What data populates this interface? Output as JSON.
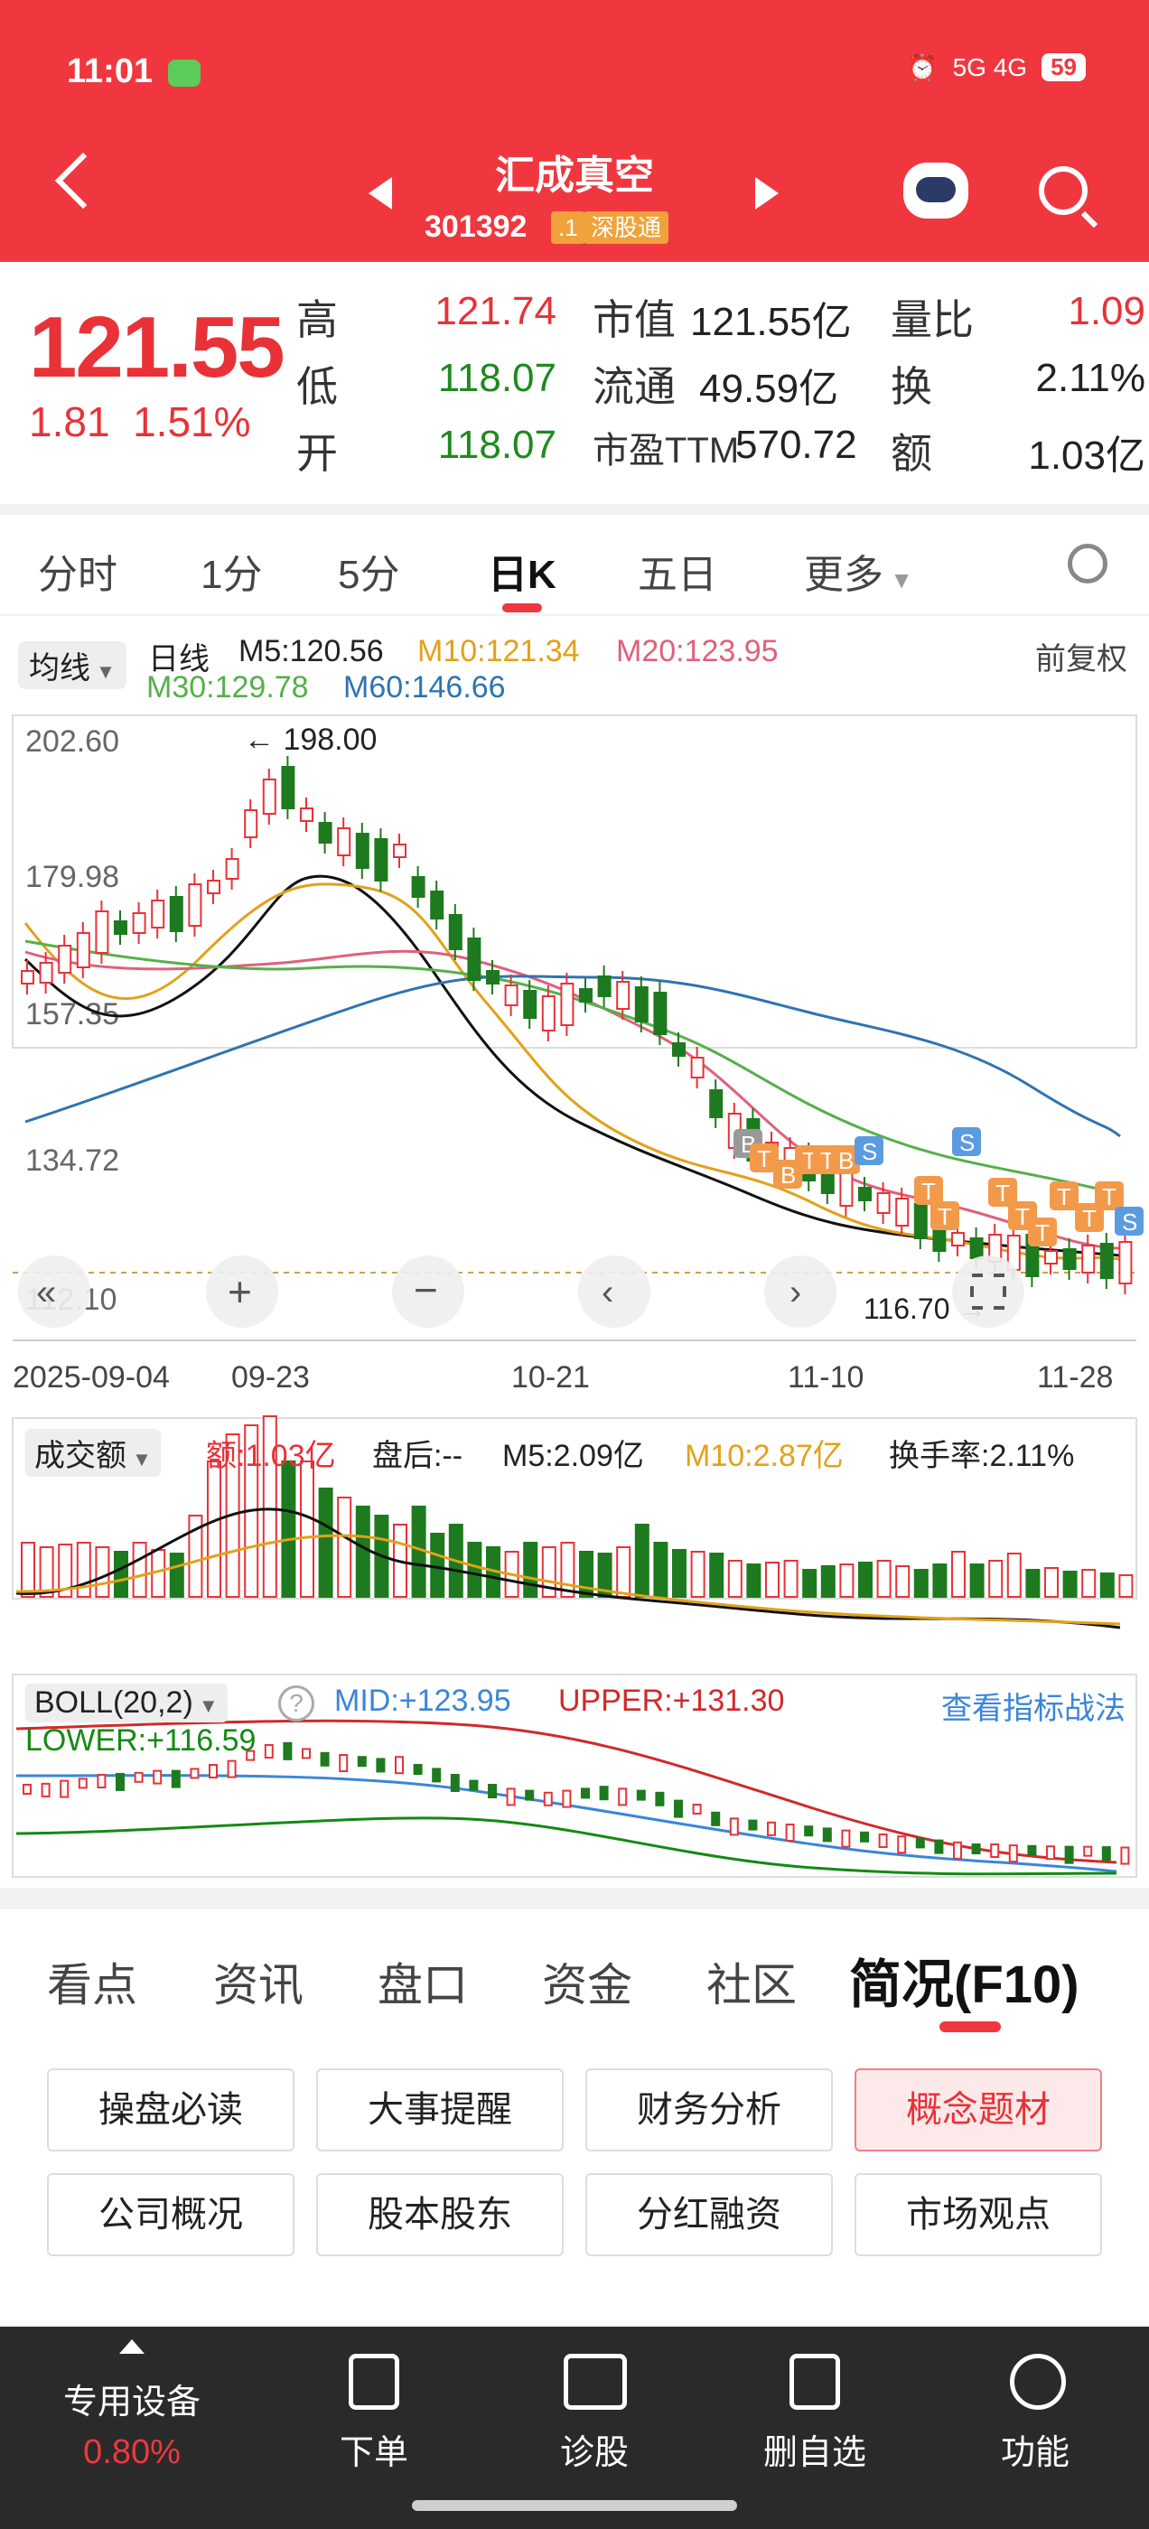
{
  "status": {
    "time": "11:01",
    "signal": "5G 4G",
    "battery": "59"
  },
  "header": {
    "stock_name": "汇成真空",
    "stock_code": "301392",
    "tag_level": ".1",
    "tag_connect": "深股通"
  },
  "quote": {
    "price": "121.55",
    "change": "1.81",
    "change_pct": "1.51%",
    "high_label": "高",
    "high": "121.74",
    "low_label": "低",
    "low": "118.07",
    "open_label": "开",
    "open": "118.07",
    "mcap_label": "市值",
    "mcap": "121.55亿",
    "float_label": "流通",
    "float": "49.59亿",
    "pe_label": "市盈TTM",
    "pe": "570.72",
    "vol_ratio_label": "量比",
    "vol_ratio": "1.09",
    "turnover_label": "换",
    "turnover": "2.11%",
    "amount_label": "额",
    "amount": "1.03亿"
  },
  "period_tabs": [
    "分时",
    "1分",
    "5分",
    "日K",
    "五日",
    "更多"
  ],
  "kline": {
    "ma_selector": "均线",
    "period": "日线",
    "m5": "M5:120.56",
    "m10": "M10:121.34",
    "m20": "M20:123.95",
    "m30": "M30:129.78",
    "m60": "M60:146.66",
    "adjust": "前复权",
    "y_ticks": [
      "202.60",
      "179.98",
      "157.35",
      "134.72",
      "112.10"
    ],
    "max_label": "198.00",
    "min_label": "116.70",
    "x_dates": [
      "2025-09-04",
      "09-23",
      "10-21",
      "11-10",
      "11-28"
    ]
  },
  "volume": {
    "selector": "成交额",
    "amount": "额:1.03亿",
    "after": "盘后:--",
    "m5": "M5:2.09亿",
    "m10": "M10:2.87亿",
    "turnover": "换手率:2.11%"
  },
  "boll": {
    "selector": "BOLL(20,2)",
    "mid": "MID:+123.95",
    "upper": "UPPER:+131.30",
    "lower": "LOWER:+116.59",
    "strategy_link": "查看指标战法"
  },
  "info_tabs": [
    "看点",
    "资讯",
    "盘口",
    "资金",
    "社区",
    "简况(F10)"
  ],
  "grid_buttons": [
    "操盘必读",
    "大事提醒",
    "财务分析",
    "概念题材",
    "公司概况",
    "股本股东",
    "分红融资",
    "市场观点"
  ],
  "bottom_nav": {
    "device_label": "专用设备",
    "device_pct": "0.80%",
    "order": "下单",
    "diagnose": "诊股",
    "remove": "删自选",
    "functions": "功能"
  },
  "colors": {
    "red": "#e83238",
    "green": "#1e7a1e",
    "header": "#f0373f",
    "m10": "#e2a11a",
    "m20": "#e0607a",
    "m30": "#55b04a",
    "m60": "#2f74b0"
  },
  "chart_data": {
    "type": "candlestick",
    "x": [
      "2025-09-04",
      "09-23",
      "10-21",
      "11-10",
      "11-28"
    ],
    "ylim": [
      112.1,
      202.6
    ],
    "y_ticks": [
      202.6,
      179.98,
      157.35,
      134.72,
      112.1
    ],
    "high_marker": 198.0,
    "low_marker": 116.7,
    "series": [
      {
        "name": "M5",
        "last": 120.56
      },
      {
        "name": "M10",
        "last": 121.34
      },
      {
        "name": "M20",
        "last": 123.95
      },
      {
        "name": "M30",
        "last": 129.78
      },
      {
        "name": "M60",
        "last": 146.66
      }
    ]
  }
}
